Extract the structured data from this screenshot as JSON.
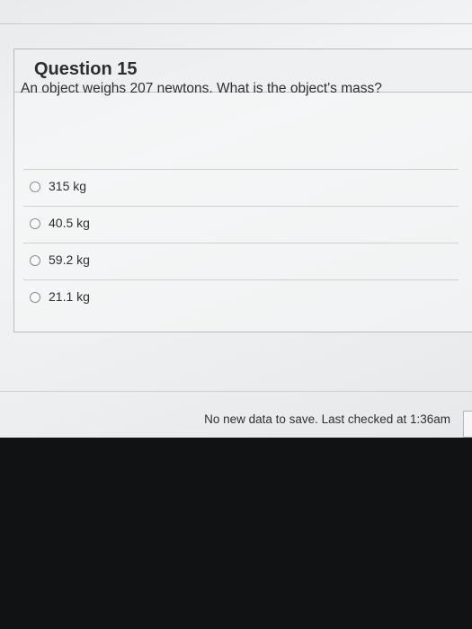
{
  "question": {
    "title": "Question 15",
    "prompt": "An object weighs 207 newtons. What is the object's mass?",
    "answers": [
      {
        "label": "315 kg"
      },
      {
        "label": "40.5 kg"
      },
      {
        "label": "59.2 kg"
      },
      {
        "label": "21.1 kg"
      }
    ]
  },
  "footer": {
    "status": "No new data to save. Last checked at 1:36am"
  }
}
